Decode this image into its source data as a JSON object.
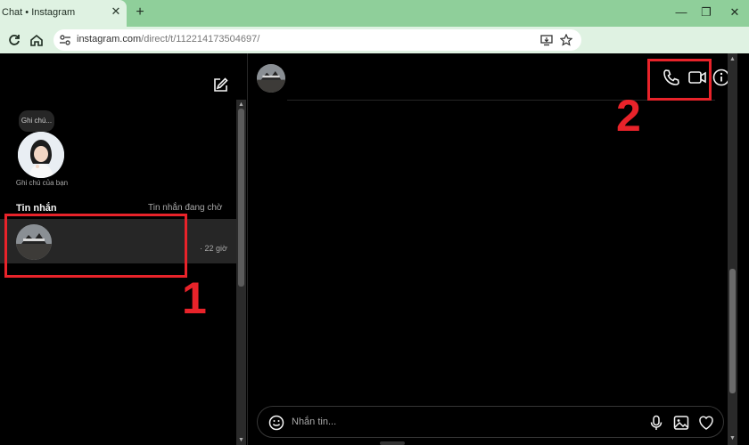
{
  "browser": {
    "tab_title": "Chat • Instagram",
    "tab_close": "✕",
    "new_tab": "+",
    "url_host": "instagram.com",
    "url_path": "/direct/t/112214173504697/",
    "minimize": "—",
    "restore": "❐",
    "close": "✕"
  },
  "sidebar": {
    "note_bubble": "Ghi chú...",
    "note_label": "Ghi chú của bạn",
    "messages_title": "Tin nhắn",
    "pending_link": "Tin nhắn đang chờ",
    "conversation_time": "· 22 giờ"
  },
  "chat": {
    "input_placeholder": "Nhắn tin..."
  },
  "annotations": {
    "step1": "1",
    "step2": "2",
    "color": "#e8232a"
  }
}
